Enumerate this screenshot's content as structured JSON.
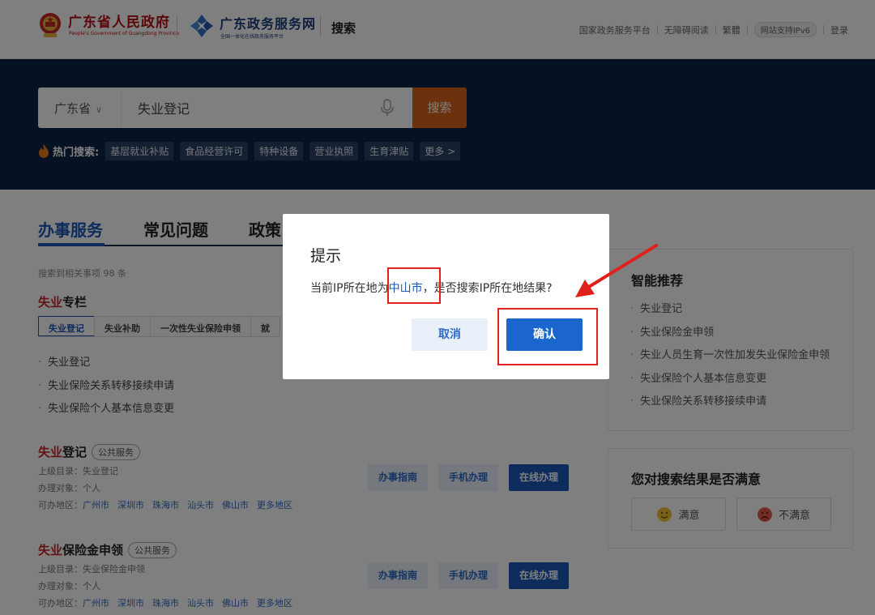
{
  "header": {
    "gov_name": "广东省人民政府",
    "gov_sub": "People's Government of Guangdong Province",
    "svc_name": "广东政务服务网",
    "svc_sub": "全国一体化在线政务服务平台",
    "page_label": "搜索",
    "links": [
      "国家政务服务平台",
      "无障碍阅读",
      "繁體"
    ],
    "ipv6": "网站支持IPv6",
    "login": "登录"
  },
  "search": {
    "region": "广东省",
    "query": "失业登记",
    "button": "搜索",
    "hot_label": "热门搜索:",
    "hot_tags": [
      "基层就业补贴",
      "食品经营许可",
      "特种设备",
      "营业执照",
      "生育津贴"
    ],
    "more": "更多 >"
  },
  "tabs": [
    "办事服务",
    "常见问题",
    "政策"
  ],
  "results": {
    "count_text": "搜索到相关事项 98 条",
    "column_title_hl": "失业",
    "column_title_rest": "专栏",
    "subtabs": [
      "失业登记",
      "失业补助",
      "一次性失业保险申领",
      "就"
    ],
    "column_items": [
      "失业登记",
      "失业保险关系转移接续申请",
      "失业保险个人基本信息变更"
    ],
    "items": [
      {
        "title_hl": "失业",
        "title_rest": "登记",
        "badge": "公共服务",
        "parent": "上级目录：失业登记",
        "target": "办理对象：个人",
        "area_label": "可办地区：",
        "areas": [
          "广州市",
          "深圳市",
          "珠海市",
          "汕头市",
          "佛山市",
          "更多地区"
        ]
      },
      {
        "title_hl": "失业",
        "title_rest": "保险金申领",
        "badge": "公共服务",
        "parent": "上级目录：失业保险金申领",
        "target": "办理对象：个人",
        "area_label": "可办地区：",
        "areas": [
          "广州市",
          "深圳市",
          "珠海市",
          "汕头市",
          "佛山市",
          "更多地区"
        ]
      }
    ],
    "btn_guide": "办事指南",
    "btn_mobile": "手机办理",
    "btn_online": "在线办理"
  },
  "recommend": {
    "title": "智能推荐",
    "items": [
      "失业登记",
      "失业保险金申领",
      "失业人员生育一次性加发失业保险金申领",
      "失业保险个人基本信息变更",
      "失业保险关系转移接续申请"
    ]
  },
  "satisfaction": {
    "title": "您对搜索结果是否满意",
    "yes": "满意",
    "no": "不满意"
  },
  "dialog": {
    "title": "提示",
    "msg_before": "当前IP所在地为",
    "city": "中山市",
    "msg_after": "，是否搜索IP所在地结果?",
    "cancel": "取消",
    "confirm": "确认"
  },
  "colors": {
    "accent": "#1a58b8",
    "banner": "#0d2446",
    "search_button": "#d9641c",
    "annotation": "#e0201a"
  }
}
